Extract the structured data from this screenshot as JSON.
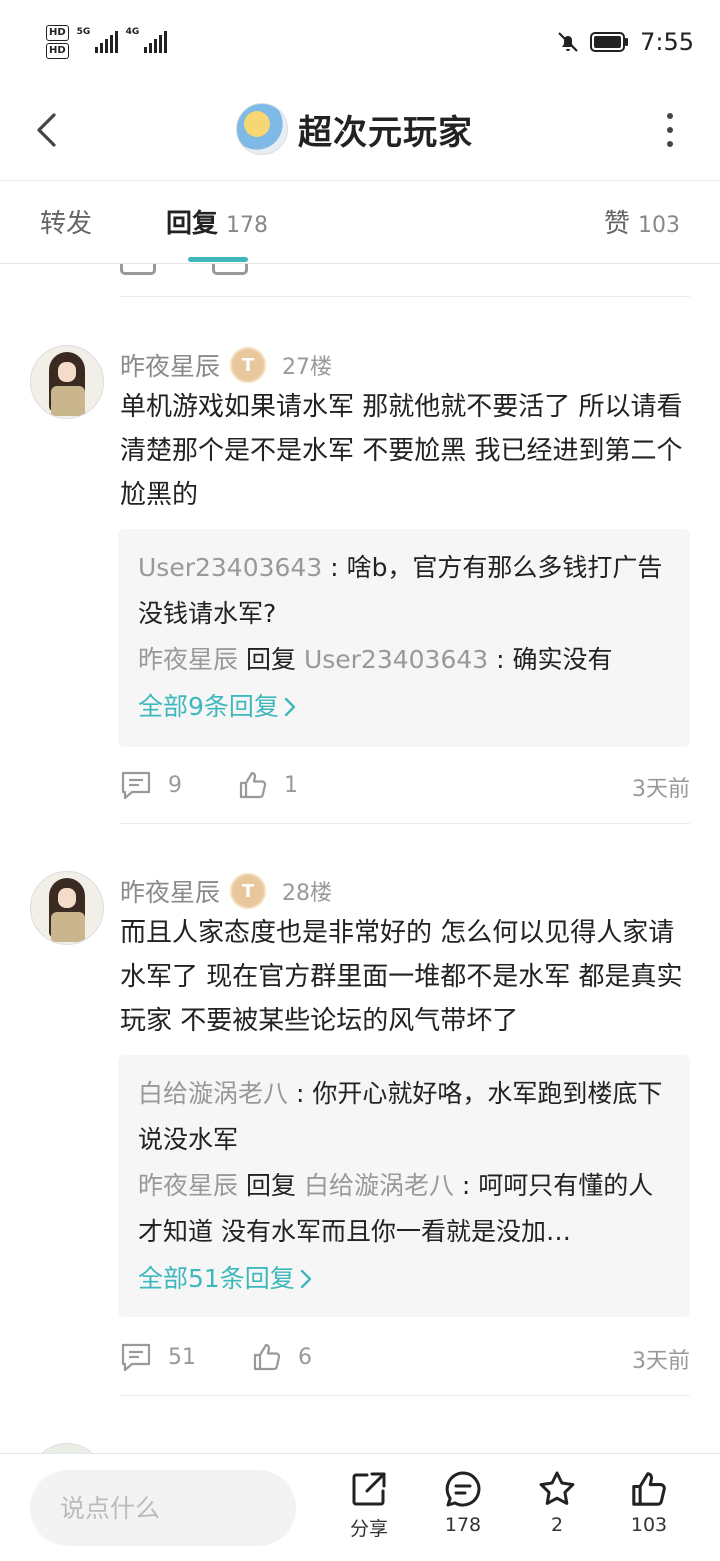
{
  "status_bar": {
    "hd1": "HD",
    "hd2": "HD",
    "net1": "5G",
    "net2": "4G",
    "time": "7:55"
  },
  "header": {
    "title": "超次元玩家",
    "icons": {
      "back": "chevron-left-icon",
      "more": "more-vertical-icon"
    }
  },
  "tabs": {
    "repost": {
      "label": "转发"
    },
    "reply": {
      "label": "回复",
      "count": "178"
    },
    "like": {
      "label": "赞",
      "count": "103"
    }
  },
  "posts": [
    {
      "username": "昨夜星辰",
      "level": "T",
      "floor": "27楼",
      "content": "单机游戏如果请水军 那就他就不要活了 所以请看清楚那个是不是水军 不要尬黑 我已经进到第二个尬黑的",
      "replies": [
        {
          "user": "User23403643",
          "sep": " : ",
          "text": "啥b，官方有那么多钱打广告没钱请水军?"
        },
        {
          "user": "昨夜星辰",
          "reply_word": "回复",
          "target": "User23403643",
          "sep": " : ",
          "text": "确实没有"
        }
      ],
      "all_replies": "全部9条回复",
      "comment_count": "9",
      "like_count": "1",
      "time": "3天前"
    },
    {
      "username": "昨夜星辰",
      "level": "T",
      "floor": "28楼",
      "content": "而且人家态度也是非常好的 怎么何以见得人家请水军了 现在官方群里面一堆都不是水军 都是真实玩家 不要被某些论坛的风气带坏了",
      "replies": [
        {
          "user": "白给漩涡老八",
          "sep": " : ",
          "text": "你开心就好咯，水军跑到楼底下说没水军"
        },
        {
          "user": "昨夜星辰",
          "reply_word": "回复",
          "target": "白给漩涡老八",
          "sep": " : ",
          "text": "呵呵只有懂的人才知道 没有水军而且你一看就是没加…"
        }
      ],
      "all_replies": "全部51条回复",
      "comment_count": "51",
      "like_count": "6",
      "time": "3天前"
    }
  ],
  "bottom_bar": {
    "input_placeholder": "说点什么",
    "share_label": "分享",
    "comment_count": "178",
    "favorite_count": "2",
    "like_count": "103"
  },
  "colors": {
    "accent": "#3fb8bd",
    "username": "#8a8a8a",
    "reply_bg": "#f6f6f6"
  }
}
